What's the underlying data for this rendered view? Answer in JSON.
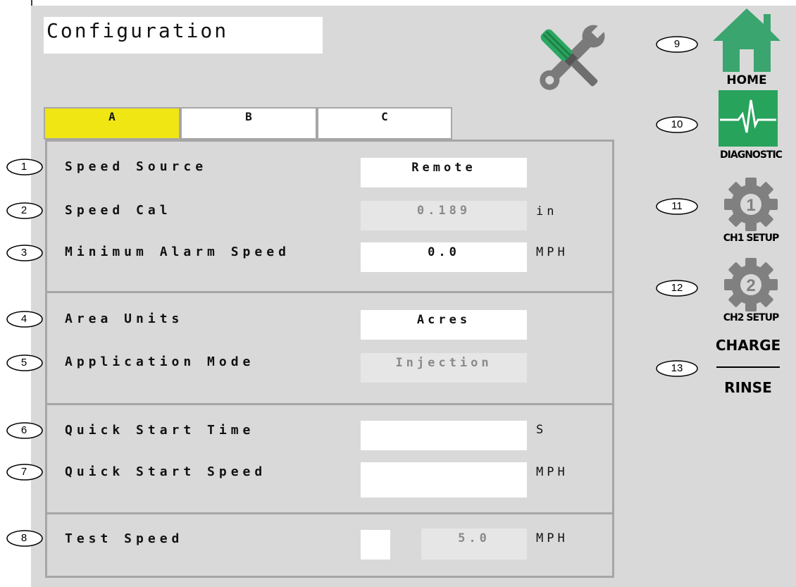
{
  "page_title": "Configuration",
  "tabs": [
    {
      "label": "A",
      "active": true
    },
    {
      "label": "B",
      "active": false
    },
    {
      "label": "C",
      "active": false
    }
  ],
  "settings": [
    {
      "num": "1",
      "label": "Speed Source",
      "value": "Remote",
      "unit": ""
    },
    {
      "num": "2",
      "label": "Speed Cal",
      "value": "0.189",
      "unit": "in"
    },
    {
      "num": "3",
      "label": "Minimum Alarm Speed",
      "value": "0.0",
      "unit": "MPH"
    },
    {
      "num": "4",
      "label": "Area Units",
      "value": "Acres",
      "unit": ""
    },
    {
      "num": "5",
      "label": "Application Mode",
      "value": "Injection",
      "unit": ""
    },
    {
      "num": "6",
      "label": "Quick Start Time",
      "value": "",
      "unit": "S"
    },
    {
      "num": "7",
      "label": "Quick Start Speed",
      "value": "",
      "unit": "MPH"
    },
    {
      "num": "8",
      "label": "Test Speed",
      "value": "5.0",
      "unit": "MPH"
    }
  ],
  "nav": {
    "home": {
      "num": "9",
      "label": "HOME",
      "icon": "home-icon"
    },
    "diagnostic": {
      "num": "10",
      "label": "DIAGNOSTIC",
      "icon": "heartbeat-icon"
    },
    "ch1": {
      "num": "11",
      "label": "CH1 SETUP",
      "icon": "gear-1-icon"
    },
    "ch2": {
      "num": "12",
      "label": "CH2 SETUP",
      "icon": "gear-2-icon"
    },
    "charge_rinse": {
      "num": "13",
      "top": "CHARGE",
      "bottom": "RINSE"
    }
  },
  "colors": {
    "background": "#d9d9d9",
    "active_tab": "#f0e614",
    "home_green": "#3aa56f",
    "diagnostic_green": "#27a35c",
    "gear_gray": "#808080"
  }
}
